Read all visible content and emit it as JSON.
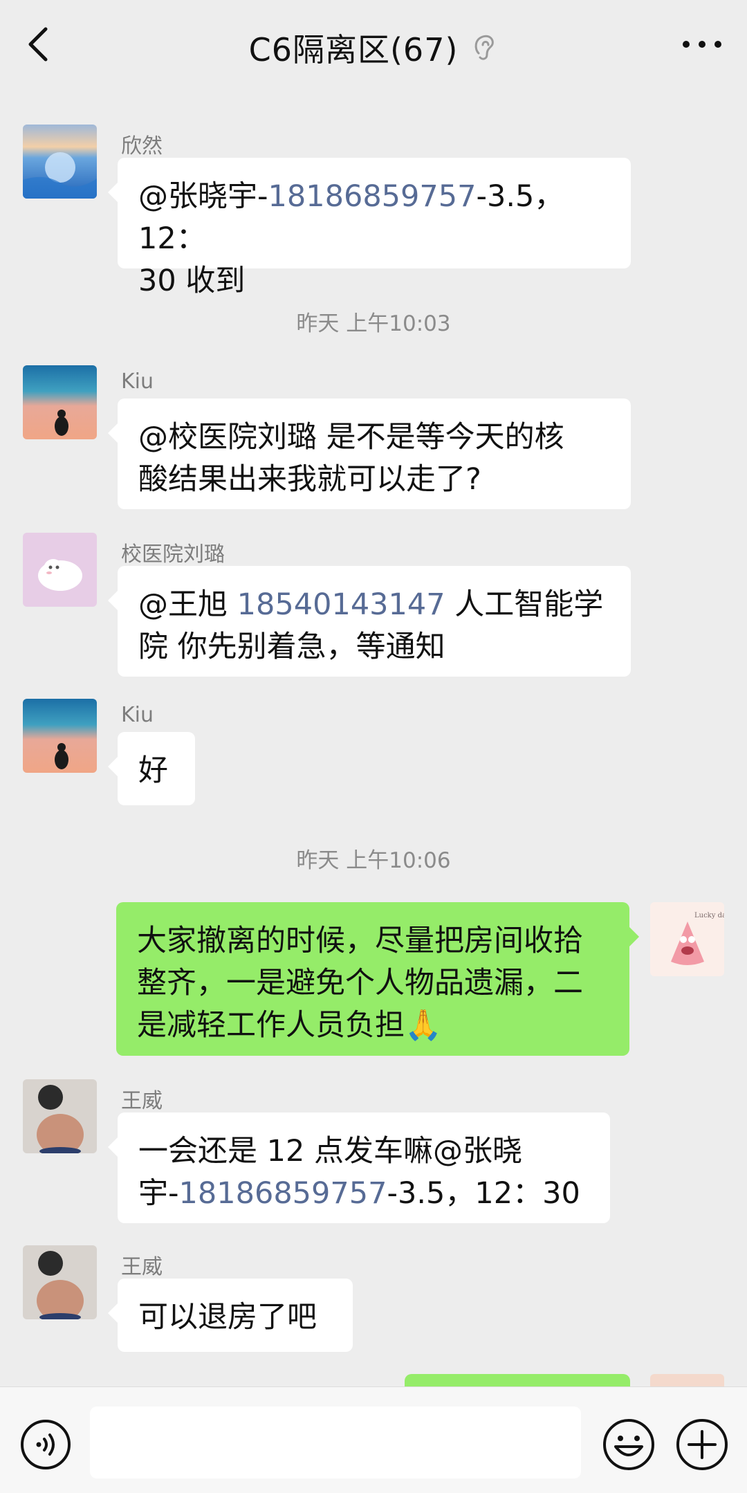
{
  "header": {
    "title": "C6隔离区(67)"
  },
  "messages": [
    {
      "sender": "欣然",
      "text_a": "@张晓宇-",
      "phone": "18186859757",
      "text_b": "-3.5，12：",
      "line2": "30  收到"
    },
    {
      "timestamp": "昨天 上午10:03"
    },
    {
      "sender": "Kiu",
      "line1": "@校医院刘璐  是不是等今天的核",
      "line2": "酸结果出来我就可以走了?"
    },
    {
      "sender": "校医院刘璐",
      "text_a": "@王旭 ",
      "phone": "18540143147",
      "text_b": " 人工智能学",
      "line2": "院  你先别着急，等通知"
    },
    {
      "sender": "Kiu",
      "line1": "好"
    },
    {
      "timestamp": "昨天 上午10:06"
    },
    {
      "mine": true,
      "line1": "大家撤离的时候，尽量把房间收拾",
      "line2": "整齐，一是避免个人物品遗漏，二",
      "line3": "是减轻工作人员负担",
      "emoji": "🙏"
    },
    {
      "sender": "王威",
      "line1": "一会还是 12 点发车嘛@张晓",
      "text_a": "宇-",
      "phone": "18186859757",
      "text_b": "-3.5，12：30"
    },
    {
      "sender": "王威",
      "line1": "可以退房了吧"
    }
  ],
  "my_avatar_text": "Lucky day",
  "input": {
    "placeholder": ""
  },
  "icons": {
    "back": "chevron-left-icon",
    "ear": "ear-icon",
    "more": "more-dots-icon",
    "voice": "voice-icon",
    "emoji": "emoji-icon",
    "plus": "plus-icon"
  },
  "colors": {
    "background": "#ededed",
    "my_bubble": "#95ec69",
    "other_bubble": "#ffffff",
    "link": "#576b95"
  }
}
